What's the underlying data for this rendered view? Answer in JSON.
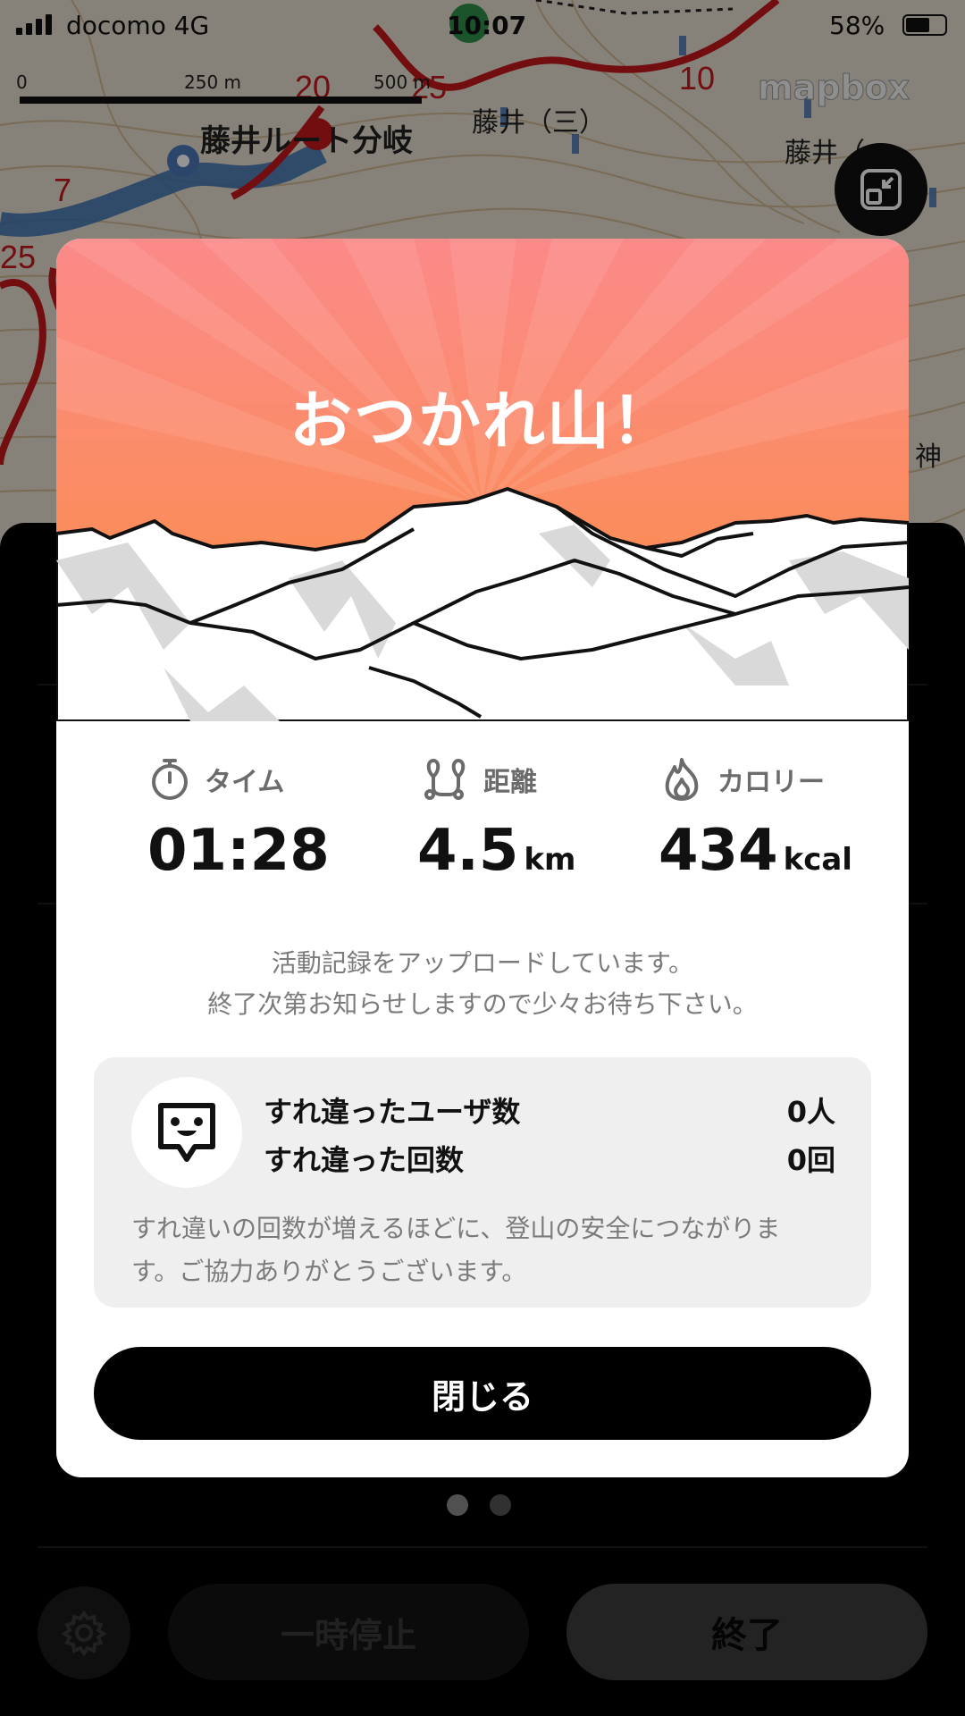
{
  "status_bar": {
    "carrier": "docomo  4G",
    "time": "10:07",
    "battery": "58%"
  },
  "map": {
    "scale": {
      "left": "0",
      "mid": "250 m",
      "right": "500 m"
    },
    "labels": {
      "route_junction": "藤井ルート分岐",
      "fujii_3": "藤井（三）",
      "fujii_right": "藤井（",
      "kami": "神"
    },
    "attribution": "mapbox",
    "fab_icon": "minimize-map-icon"
  },
  "modal": {
    "title": "おつかれ山！",
    "stats": [
      {
        "icon": "stopwatch-icon",
        "label": "タイム",
        "value": "01:28",
        "unit": ""
      },
      {
        "icon": "route-icon",
        "label": "距離",
        "value": "4.5",
        "unit": "km"
      },
      {
        "icon": "flame-icon",
        "label": "カロリー",
        "value": "434",
        "unit": "kcal"
      }
    ],
    "upload_line1": "活動記録をアップロードしています。",
    "upload_line2": "終了次第お知らせしますので少々お待ち下さい。",
    "encounter": {
      "icon": "chat-face-icon",
      "users_label": "すれ違ったユーザ数",
      "users_value": "0人",
      "count_label": "すれ違った回数",
      "count_value": "0回",
      "note_line1": "すれ違いの回数が増えるほどに、登山の安全につながりま",
      "note_line2": "す。ご協力ありがとうございます。"
    },
    "close_button": "閉じる"
  },
  "bottom": {
    "pause_button": "一時停止",
    "end_button": "終了",
    "settings_icon": "gear-icon",
    "page_dots": 2,
    "active_dot": 0
  },
  "colors": {
    "hero_top": "#fb8c86",
    "hero_bottom": "#fb8b3d",
    "accent_dark": "#000000"
  }
}
